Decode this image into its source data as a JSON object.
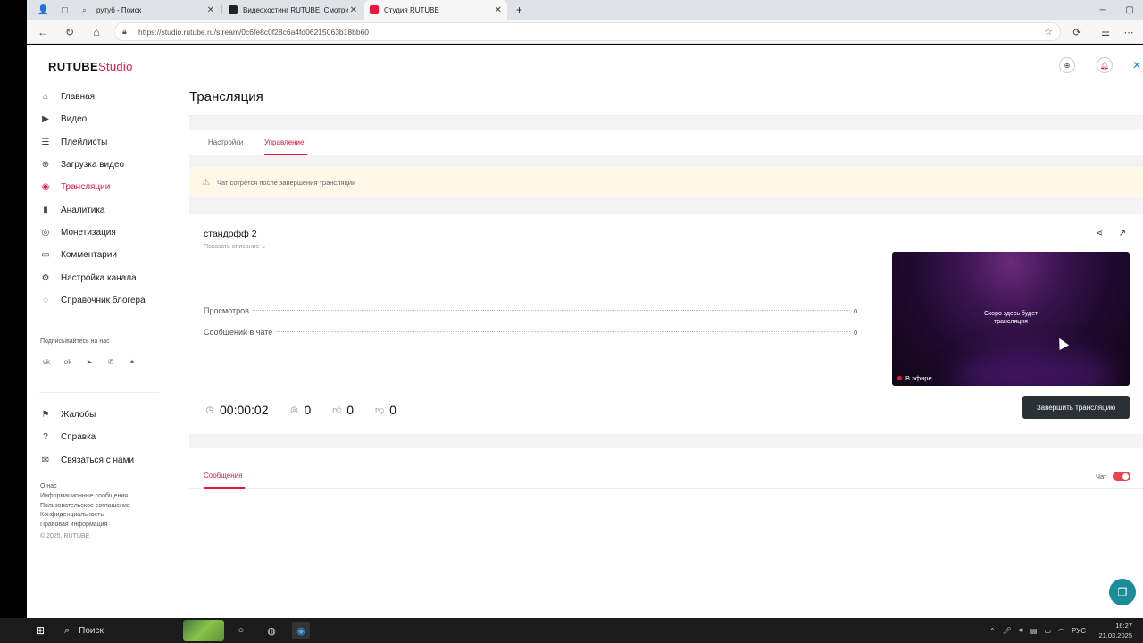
{
  "browser": {
    "tabs": [
      {
        "title": "рутуб - Поиск"
      },
      {
        "title": "Видеохостинг RUTUBE. Смотрит..."
      },
      {
        "title": "Студия RUTUBE"
      }
    ],
    "url": "https://studio.rutube.ru/stream/0c6fe8c0f28c6a4fd06215063b18bb60"
  },
  "brand": {
    "name": "RUTUBE",
    "suffix": "Studio"
  },
  "sidebar": {
    "items": [
      {
        "label": "Главная"
      },
      {
        "label": "Видео"
      },
      {
        "label": "Плейлисты"
      },
      {
        "label": "Загрузка видео"
      },
      {
        "label": "Трансляции"
      },
      {
        "label": "Аналитика"
      },
      {
        "label": "Монетизация"
      },
      {
        "label": "Комментарии"
      },
      {
        "label": "Настройка канала"
      },
      {
        "label": "Справочник блогера"
      }
    ],
    "subscribe_heading": "Подписывайтесь на нас",
    "bottom_items": [
      {
        "label": "Жалобы"
      },
      {
        "label": "Справка"
      },
      {
        "label": "Связаться с нами"
      }
    ],
    "footer_links": [
      "О нас",
      "Информационные сообщения",
      "Пользовательское соглашение",
      "Конфиденциальность",
      "Правовая информация"
    ],
    "copyright": "© 2025, RUTUBE"
  },
  "main": {
    "title": "Трансляция",
    "tabs": [
      "Настройки",
      "Управление"
    ],
    "warning": "Чат сотрётся после завершения трансляции",
    "stream": {
      "name": "стандофф 2",
      "show_description": "Показать описание",
      "stats": [
        {
          "label": "Просмотров",
          "value": "0"
        },
        {
          "label": "Сообщений в чате",
          "value": "0"
        }
      ],
      "timer": "00:00:02",
      "viewers": "0",
      "likes": "0",
      "dislikes": "0",
      "preview_text_1": "Скоро здесь будет",
      "preview_text_2": "трансляция",
      "on_air": "В эфире",
      "end_button": "Завершить трансляцию"
    },
    "chat": {
      "tab": "Сообщения",
      "toggle_label": "Чат",
      "toggle_on": true
    }
  },
  "taskbar": {
    "search_placeholder": "Поиск",
    "lang": "РУС",
    "time": "16:27",
    "date": "21.03.2025"
  },
  "colors": {
    "accent": "#ed143b",
    "button_dark": "#2b2f36",
    "warning_bg": "#fff8e8",
    "fab": "#1a8d9a"
  }
}
